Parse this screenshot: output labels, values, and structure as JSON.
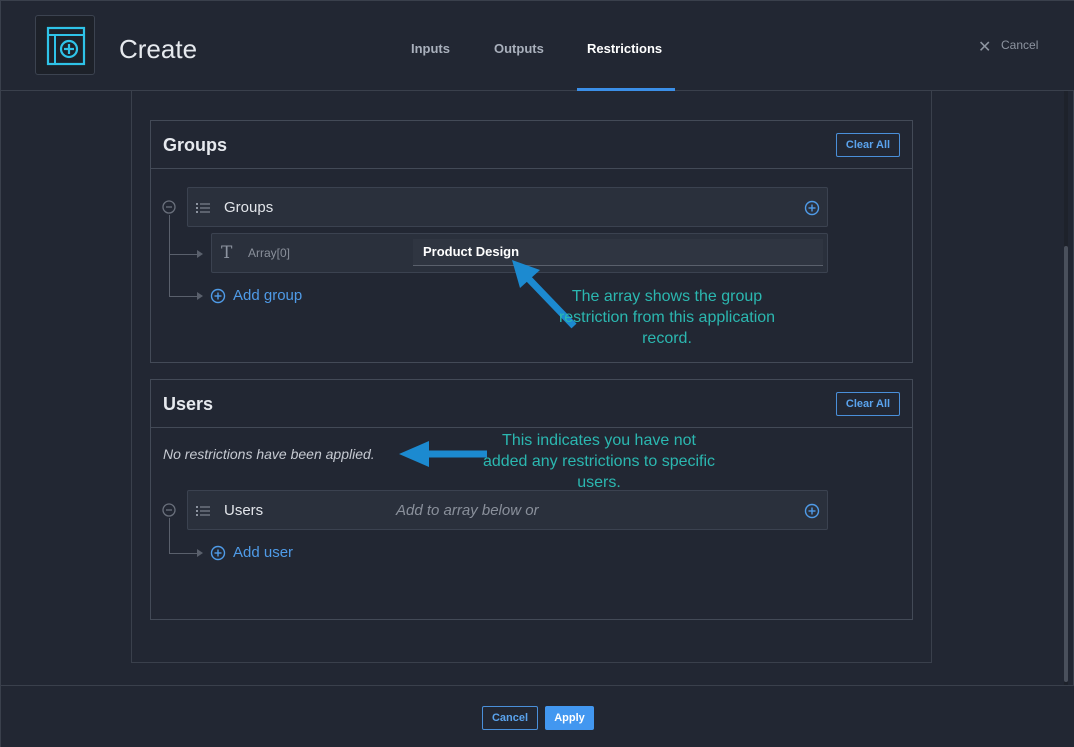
{
  "header": {
    "title": "Create",
    "tabs": [
      {
        "label": "Inputs"
      },
      {
        "label": "Outputs"
      },
      {
        "label": "Restrictions",
        "active": true
      }
    ],
    "cancel_label": "Cancel"
  },
  "groups_section": {
    "title": "Groups",
    "clear_label": "Clear All",
    "array_label": "Groups",
    "item": {
      "key": "Array[0]",
      "value": "Product Design"
    },
    "add_label": "Add group",
    "annotation": "The array shows the group restriction from this application record."
  },
  "users_section": {
    "title": "Users",
    "clear_label": "Clear All",
    "empty_message": "No restrictions have been applied.",
    "array_label": "Users",
    "placeholder": "Add to array below or",
    "add_label": "Add user",
    "annotation": "This indicates you have not added any restrictions to specific users."
  },
  "footer": {
    "cancel_label": "Cancel",
    "apply_label": "Apply"
  },
  "colors": {
    "accent": "#4297f0",
    "annotation": "#2bb7b0",
    "arrow": "#1c8ad0"
  },
  "icons": [
    "app-create-icon",
    "close-icon",
    "list-icon",
    "plus-circle-icon",
    "minus-circle-icon",
    "text-type-icon"
  ]
}
